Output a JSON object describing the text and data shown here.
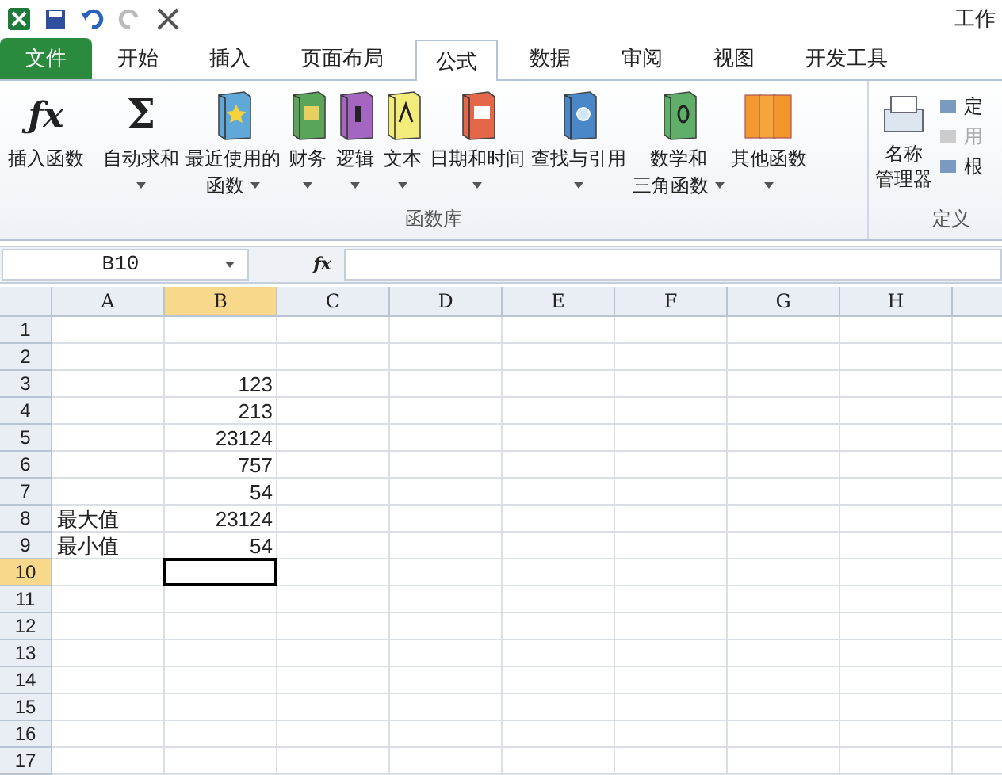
{
  "window": {
    "title": "工作"
  },
  "tabs": [
    {
      "label": "文件",
      "kind": "file",
      "selected": false
    },
    {
      "label": "开始",
      "kind": "tab",
      "selected": false
    },
    {
      "label": "插入",
      "kind": "tab",
      "selected": false
    },
    {
      "label": "页面布局",
      "kind": "tab",
      "selected": false
    },
    {
      "label": "公式",
      "kind": "tab",
      "selected": true
    },
    {
      "label": "数据",
      "kind": "tab",
      "selected": false
    },
    {
      "label": "审阅",
      "kind": "tab",
      "selected": false
    },
    {
      "label": "视图",
      "kind": "tab",
      "selected": false
    },
    {
      "label": "开发工具",
      "kind": "tab",
      "selected": false
    }
  ],
  "ribbon": {
    "group_label": "函数库",
    "side_label": "定义",
    "buttons": [
      {
        "kind": "fx",
        "glyph": "ƒx",
        "lines": [
          "插入函数"
        ],
        "dropdown": false
      },
      {
        "kind": "sigma",
        "glyph": "Σ",
        "lines": [
          "自动求和"
        ],
        "dropdown": true
      },
      {
        "kind": "star",
        "lines": [
          "最近使用的",
          "函数"
        ],
        "dropdown": true
      },
      {
        "kind": "money",
        "lines": [
          "财务"
        ],
        "dropdown": true
      },
      {
        "kind": "question",
        "lines": [
          "逻辑"
        ],
        "dropdown": true
      },
      {
        "kind": "letter",
        "lines": [
          "文本"
        ],
        "dropdown": true
      },
      {
        "kind": "clock",
        "lines": [
          "日期和时间"
        ],
        "dropdown": true
      },
      {
        "kind": "lens",
        "lines": [
          "查找与引用"
        ],
        "dropdown": true
      },
      {
        "kind": "theta",
        "lines": [
          "数学和",
          "三角函数"
        ],
        "dropdown": true
      },
      {
        "kind": "books",
        "lines": [
          "其他函数"
        ],
        "dropdown": true
      }
    ],
    "name_manager": [
      "名称",
      "管理器"
    ],
    "side_items": [
      {
        "label": "定",
        "disabled": false
      },
      {
        "label": "用",
        "disabled": true
      },
      {
        "label": "根",
        "disabled": false
      }
    ]
  },
  "formula_bar": {
    "name_box": "B10",
    "fx": "fx"
  },
  "columns": [
    {
      "label": "A",
      "selected": false
    },
    {
      "label": "B",
      "selected": true
    },
    {
      "label": "C",
      "selected": false
    },
    {
      "label": "D",
      "selected": false
    },
    {
      "label": "E",
      "selected": false
    },
    {
      "label": "F",
      "selected": false
    },
    {
      "label": "G",
      "selected": false
    },
    {
      "label": "H",
      "selected": false
    }
  ],
  "rows": [
    {
      "label": "1",
      "selected": false,
      "a": "",
      "b": "",
      "b_selected": false
    },
    {
      "label": "2",
      "selected": false,
      "a": "",
      "b": "",
      "b_selected": false
    },
    {
      "label": "3",
      "selected": false,
      "a": "",
      "b": "123",
      "b_selected": false
    },
    {
      "label": "4",
      "selected": false,
      "a": "",
      "b": "213",
      "b_selected": false
    },
    {
      "label": "5",
      "selected": false,
      "a": "",
      "b": "23124",
      "b_selected": false
    },
    {
      "label": "6",
      "selected": false,
      "a": "",
      "b": "757",
      "b_selected": false
    },
    {
      "label": "7",
      "selected": false,
      "a": "",
      "b": "54",
      "b_selected": false
    },
    {
      "label": "8",
      "selected": false,
      "a": "最大值",
      "b": "23124",
      "b_selected": false
    },
    {
      "label": "9",
      "selected": false,
      "a": "最小值",
      "b": "54",
      "b_selected": false
    },
    {
      "label": "10",
      "selected": true,
      "a": "",
      "b": "",
      "b_selected": true
    },
    {
      "label": "11",
      "selected": false,
      "a": "",
      "b": "",
      "b_selected": false
    },
    {
      "label": "12",
      "selected": false,
      "a": "",
      "b": "",
      "b_selected": false
    },
    {
      "label": "13",
      "selected": false,
      "a": "",
      "b": "",
      "b_selected": false
    },
    {
      "label": "14",
      "selected": false,
      "a": "",
      "b": "",
      "b_selected": false
    },
    {
      "label": "15",
      "selected": false,
      "a": "",
      "b": "",
      "b_selected": false
    },
    {
      "label": "16",
      "selected": false,
      "a": "",
      "b": "",
      "b_selected": false
    },
    {
      "label": "17",
      "selected": false,
      "a": "",
      "b": "",
      "b_selected": false
    }
  ]
}
